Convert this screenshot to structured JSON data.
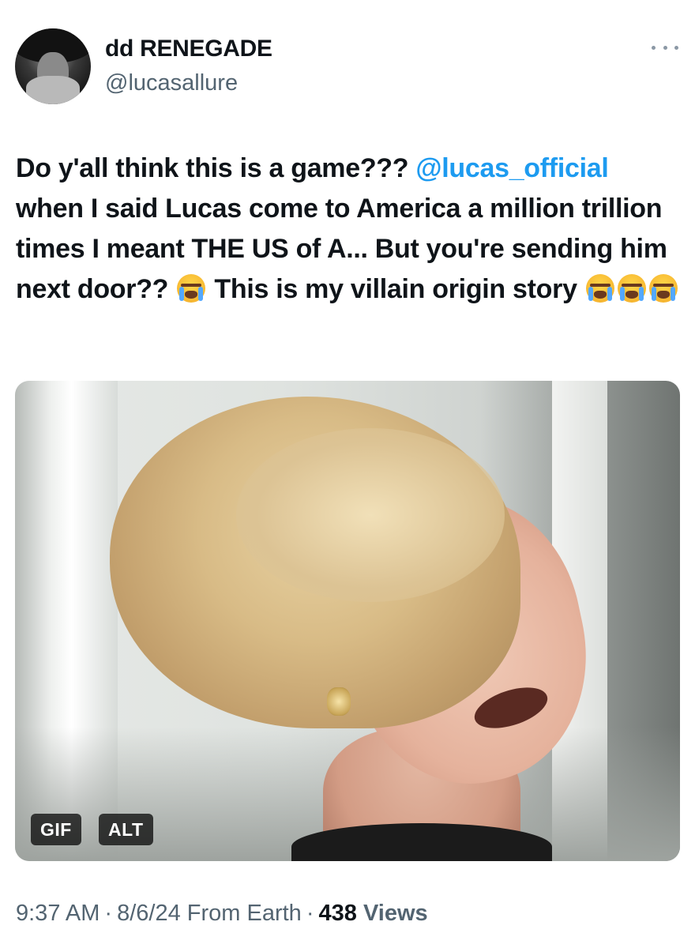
{
  "author": {
    "display_name": "dd RENEGADE",
    "handle": "@lucasallure"
  },
  "tweet": {
    "text_part1": "Do y'all think this is a game??? ",
    "mention": "@lucas_official",
    "text_part2": " when I said Lucas come to America a million trillion times I meant THE US of A... But you're sending him next door?? ",
    "text_part3": " This is my villain origin story ",
    "emoji_name": "loudly-crying-face"
  },
  "media": {
    "gif_badge": "GIF",
    "alt_badge": "ALT"
  },
  "meta": {
    "time": "9:37 AM",
    "separator": "·",
    "date": "8/6/24",
    "source": "From Earth",
    "views_count": "438",
    "views_label": "Views"
  },
  "colors": {
    "link": "#1d9bf0",
    "secondary_text": "#536471",
    "primary_text": "#0f1419"
  }
}
